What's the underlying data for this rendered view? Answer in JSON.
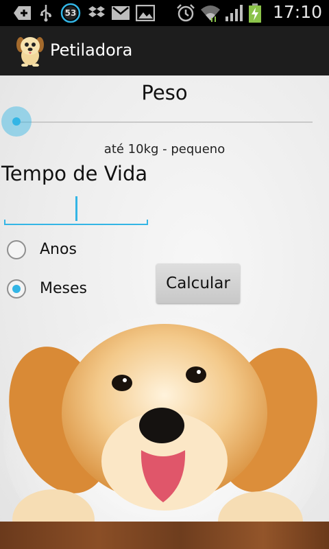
{
  "status_bar": {
    "time": "17:10",
    "notification_badge": "53",
    "icons": [
      "add-icon",
      "usb-icon",
      "sync-badge-icon",
      "dropbox-icon",
      "gmail-icon",
      "gallery-icon",
      "alarm-icon",
      "wifi-icon",
      "signal-icon",
      "battery-charging-icon"
    ]
  },
  "action_bar": {
    "title": "Petiladora",
    "logo": "dog-logo-icon"
  },
  "form": {
    "peso_label": "Peso",
    "peso_description": "até 10kg - pequeno",
    "peso_slider_value": 0,
    "tempo_label": "Tempo de Vida",
    "tempo_value": "",
    "radio_anos": "Anos",
    "radio_meses": "Meses",
    "selected_unit": "Meses",
    "calculate_button": "Calcular"
  },
  "colors": {
    "accent": "#33b5e5",
    "action_bar": "#1d1d1d",
    "status_bar": "#000000"
  }
}
